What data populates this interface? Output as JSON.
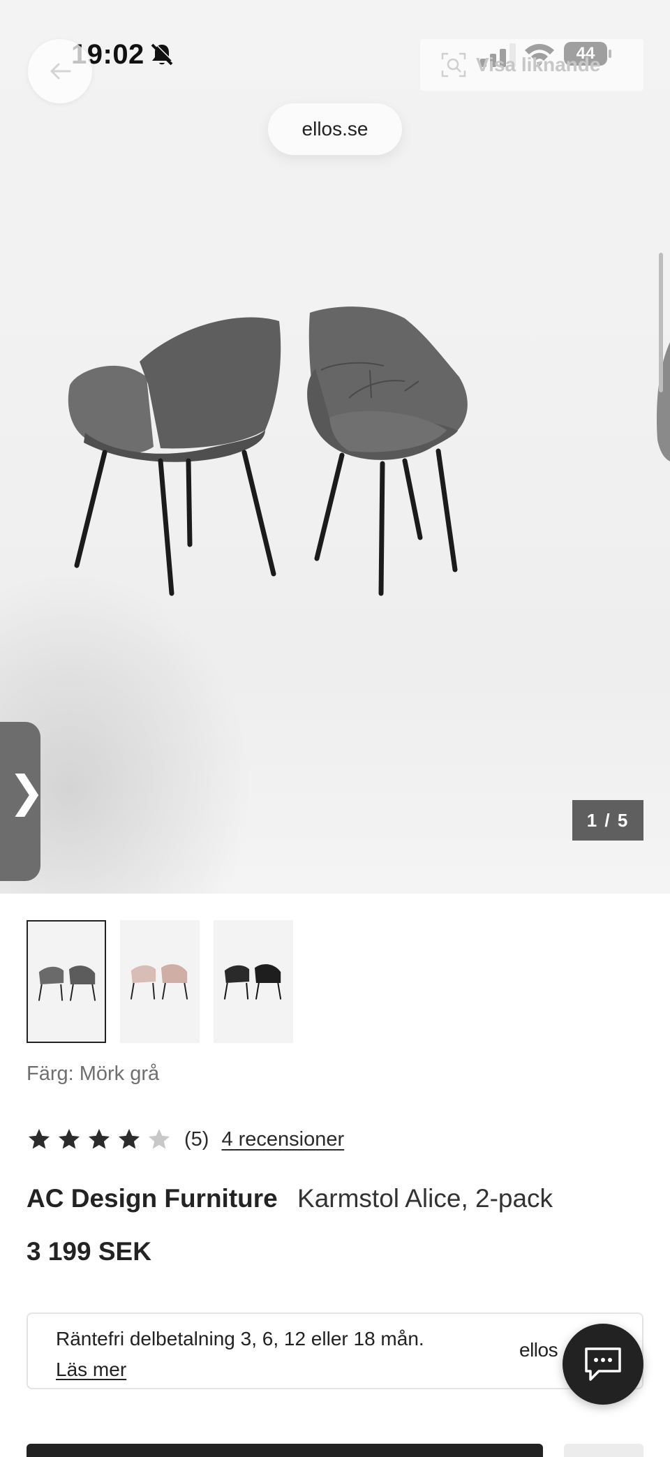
{
  "status_bar": {
    "time": "19:02",
    "battery": "44"
  },
  "top_nav": {
    "similar_label": "Visa liknande",
    "url": "ellos.se"
  },
  "gallery": {
    "counter": "1 / 5",
    "side_tab_glyph": "❯"
  },
  "variants": {
    "color_label": "Färg: Mörk grå",
    "thumbnails": [
      "dark-grey",
      "pink",
      "black"
    ]
  },
  "rating": {
    "stars": 4,
    "max_stars": 5,
    "count_text": "(5)",
    "reviews_link": "4 recensioner"
  },
  "product": {
    "brand": "AC Design Furniture",
    "name": "Karmstol Alice, 2-pack",
    "price": "3 199 SEK"
  },
  "financing": {
    "text": "Räntefri delbetalning 3, 6, 12 eller 18 mån.",
    "link": "Läs mer",
    "logo": "ellos"
  },
  "icons": {
    "back": "back-arrow-icon",
    "similar": "visual-search-icon",
    "chat": "chat-icon"
  },
  "colors": {
    "accent": "#222222",
    "hero_bg": "#f1f1f1",
    "counter_bg": "#5f5f5f",
    "star_filled": "#2b2b2b",
    "star_empty": "#c8c8c8"
  }
}
